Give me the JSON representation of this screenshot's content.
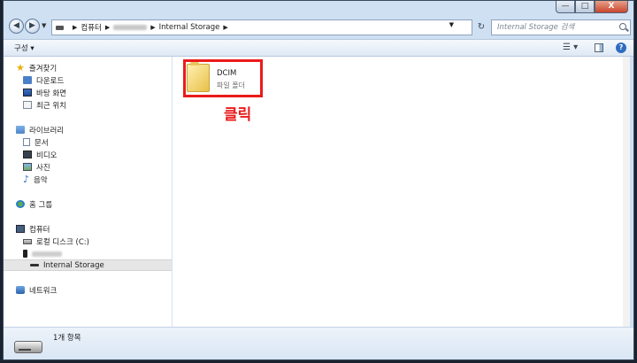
{
  "window": {
    "caption": {
      "minimize": "—",
      "maximize": "□",
      "close": "X"
    }
  },
  "address_bar": {
    "crumbs": [
      "컴퓨터",
      "Internal Storage"
    ],
    "search_placeholder": "Internal Storage 검색"
  },
  "toolbar": {
    "organize_label": "구성 ▾"
  },
  "nav": {
    "favorites": {
      "label": "즐겨찾기",
      "items": [
        "다운로드",
        "바탕 화면",
        "최근 위치"
      ]
    },
    "libraries": {
      "label": "라이브러리",
      "items": [
        "문서",
        "비디오",
        "사진",
        "음악"
      ]
    },
    "homegroup": {
      "label": "홈 그룹"
    },
    "computer": {
      "label": "컴퓨터",
      "items": [
        "로컬 디스크 (C:)",
        "Internal Storage"
      ]
    },
    "network": {
      "label": "네트워크"
    }
  },
  "content": {
    "folder": {
      "name": "DCIM",
      "type": "파일 폴더"
    },
    "annotation": "클릭"
  },
  "status": {
    "item_count": "1개 항목"
  },
  "colors": {
    "highlight": "#ea1b1b",
    "window_frame": "#cfe0f2"
  }
}
